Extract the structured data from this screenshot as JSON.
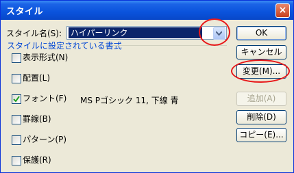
{
  "window": {
    "title": "スタイル",
    "close_symbol": "×"
  },
  "style_name": {
    "label": "スタイル名(S):",
    "value": "ハイパーリンク"
  },
  "section": {
    "label": "スタイルに設定されている書式"
  },
  "checkboxes": [
    {
      "label": "表示形式(N)",
      "checked": false
    },
    {
      "label": "配置(L)",
      "checked": false
    },
    {
      "label": "フォント(F)",
      "checked": true
    },
    {
      "label": "罫線(B)",
      "checked": false
    },
    {
      "label": "パターン(P)",
      "checked": false
    },
    {
      "label": "保護(R)",
      "checked": false
    }
  ],
  "font_description": "MS Pゴシック 11, 下線 青",
  "buttons": {
    "ok": "OK",
    "cancel": "キャンセル",
    "modify": "変更(M)...",
    "add": "追加(A)",
    "delete": "削除(D)",
    "copy": "コピー(E)..."
  },
  "colors": {
    "title_bar": "#0a53dc",
    "section_label": "#0046d5",
    "annotation_circle": "#e8181a"
  }
}
